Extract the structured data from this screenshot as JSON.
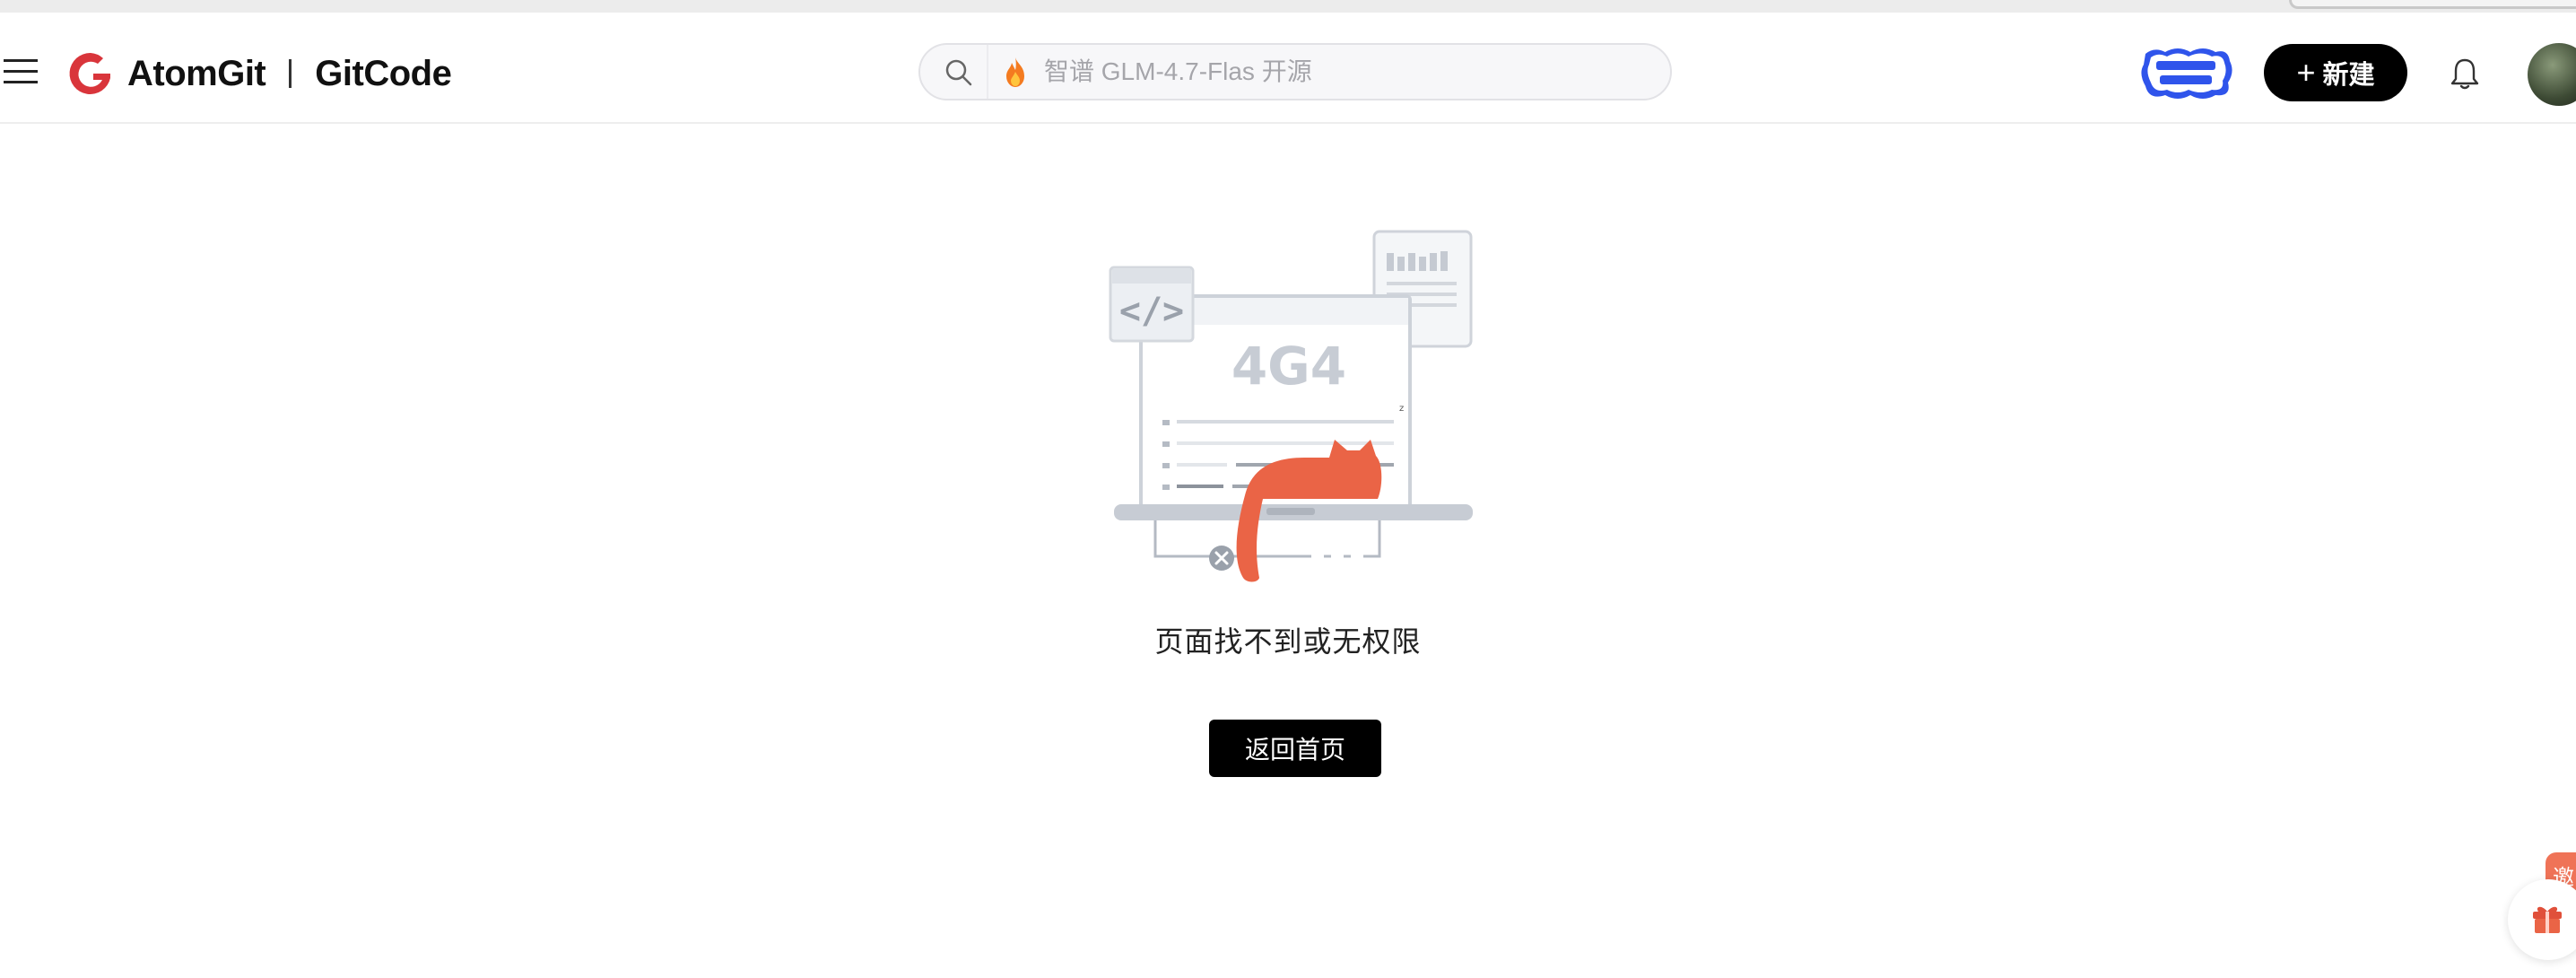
{
  "header": {
    "brand_primary": "AtomGit",
    "brand_secondary": "GitCode",
    "search": {
      "placeholder": "智谱 GLM-4.7-Flas 开源"
    },
    "new_button_label": "新建",
    "icons": {
      "menu": "hamburger-menu-icon",
      "search": "search-icon",
      "hot": "fire-icon",
      "notifications": "bell-icon"
    }
  },
  "main": {
    "illustration_code": "4G4",
    "error_message": "页面找不到或无权限",
    "home_button_label": "返回首页"
  },
  "floating": {
    "invite_label": "邀"
  },
  "colors": {
    "brand_red": "#d9353b",
    "accent_cat": "#ea6446",
    "button_black": "#000000"
  }
}
